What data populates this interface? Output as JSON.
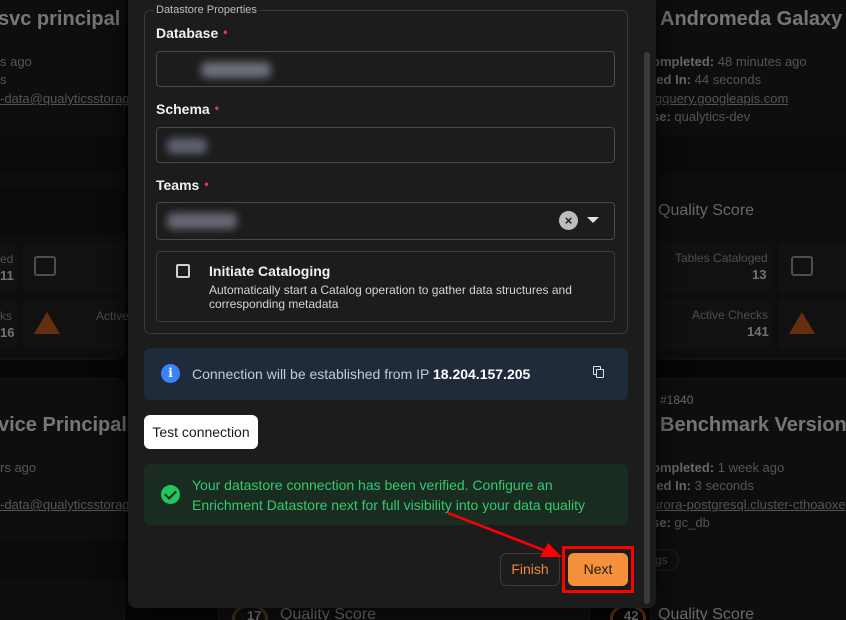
{
  "background": {
    "left_top": {
      "title": "svc principal",
      "line1": "s ago",
      "line2": "s",
      "link": "-data@qualyticsstorag",
      "stat1_label": "ed",
      "stat1_value": "11",
      "stat2_label": "ks",
      "stat2_value": "16",
      "stat3_label": "Active"
    },
    "right_top": {
      "title": "Andromeda Galaxy",
      "completed_label": "ompleted:",
      "completed_value": "48 minutes ago",
      "in_label": "ted In:",
      "in_value": "44 seconds",
      "link": "igquery.googleapis.com",
      "env_label": "se:",
      "env_value": "qualytics-dev",
      "quality_score_label": "Quality Score",
      "tables_label": "Tables Cataloged",
      "tables_value": "13",
      "checks_label": "Active Checks",
      "checks_value": "141"
    },
    "left_bottom": {
      "title": "vice Principal",
      "line1": "rs ago",
      "link": "-data@qualyticsstorag"
    },
    "right_bottom": {
      "id": "#1840",
      "title": "Benchmark Versione",
      "completed_label": "ompleted:",
      "completed_value": "1 week ago",
      "in_label": "ted In:",
      "in_value": "3 seconds",
      "link": "urora-postgresql.cluster-cthoaoxe",
      "env_label": "se:",
      "env_value": "gc_db",
      "tag": "gs",
      "score_value": "42",
      "quality_score_label": "Quality Score"
    },
    "bottom_center": {
      "score_value": "17",
      "quality_score_label": "Quality Score"
    }
  },
  "modal": {
    "section_title": "Datastore Properties",
    "database_label": "Database",
    "schema_label": "Schema",
    "teams_label": "Teams",
    "required_mark": "•",
    "clear_icon": "×",
    "catalog_title": "Initiate Cataloging",
    "catalog_desc": "Automatically start a Catalog operation to gather data structures and corresponding metadata",
    "info_prefix": "Connection will be established from IP",
    "info_ip": "18.204.157.205",
    "info_icon": "i",
    "test_button": "Test connection",
    "success_text": "Your datastore connection has been verified. Configure an Enrichment Datastore next for full visibility into your data quality",
    "finish_button": "Finish",
    "next_button": "Next"
  },
  "colors": {
    "accent": "#f4913a",
    "success": "#35c972",
    "info": "#3b82f6",
    "required": "#e8356a",
    "highlight": "#ff0000"
  }
}
